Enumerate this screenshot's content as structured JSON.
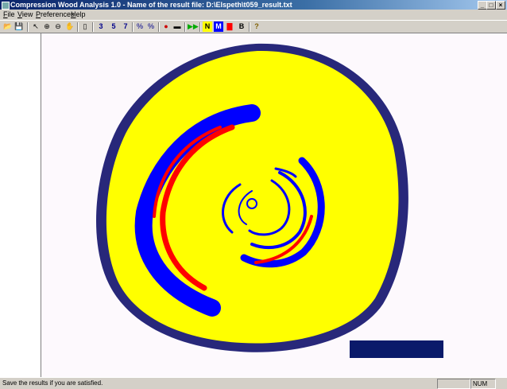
{
  "window": {
    "title": "Compression Wood Analysis 1.0 - Name of the result file: D:\\Elspeth\\t059_result.txt"
  },
  "menu": [
    {
      "label": "File",
      "u": "F",
      "rest": "ile"
    },
    {
      "label": "View",
      "u": "V",
      "rest": "iew"
    },
    {
      "label": "Preferences",
      "u": "P",
      "rest": "references"
    },
    {
      "label": "Help",
      "u": "H",
      "rest": "elp"
    }
  ],
  "toolbar": {
    "open": "📂",
    "save": "💾",
    "pointer": "↖",
    "zoom_in": "⊕",
    "zoom_out": "⊖",
    "hand": "✋",
    "doc": "▯",
    "b3": "3",
    "b5": "5",
    "b7": "7",
    "pct1": "%",
    "pct2": "%",
    "n": "N",
    "m": "M",
    "r": "▇",
    "b": "B",
    "help": "?"
  },
  "status": {
    "message": "Save the results if you are satisfied.",
    "num": "NUM"
  },
  "image": {
    "description_colors": {
      "background": "#ffffff",
      "wood": "#ffff00",
      "bark": "#28287a",
      "compression_mild": "#0000ff",
      "compression_severe": "#ff0000",
      "scale_bar": "#0a1a6a"
    }
  }
}
